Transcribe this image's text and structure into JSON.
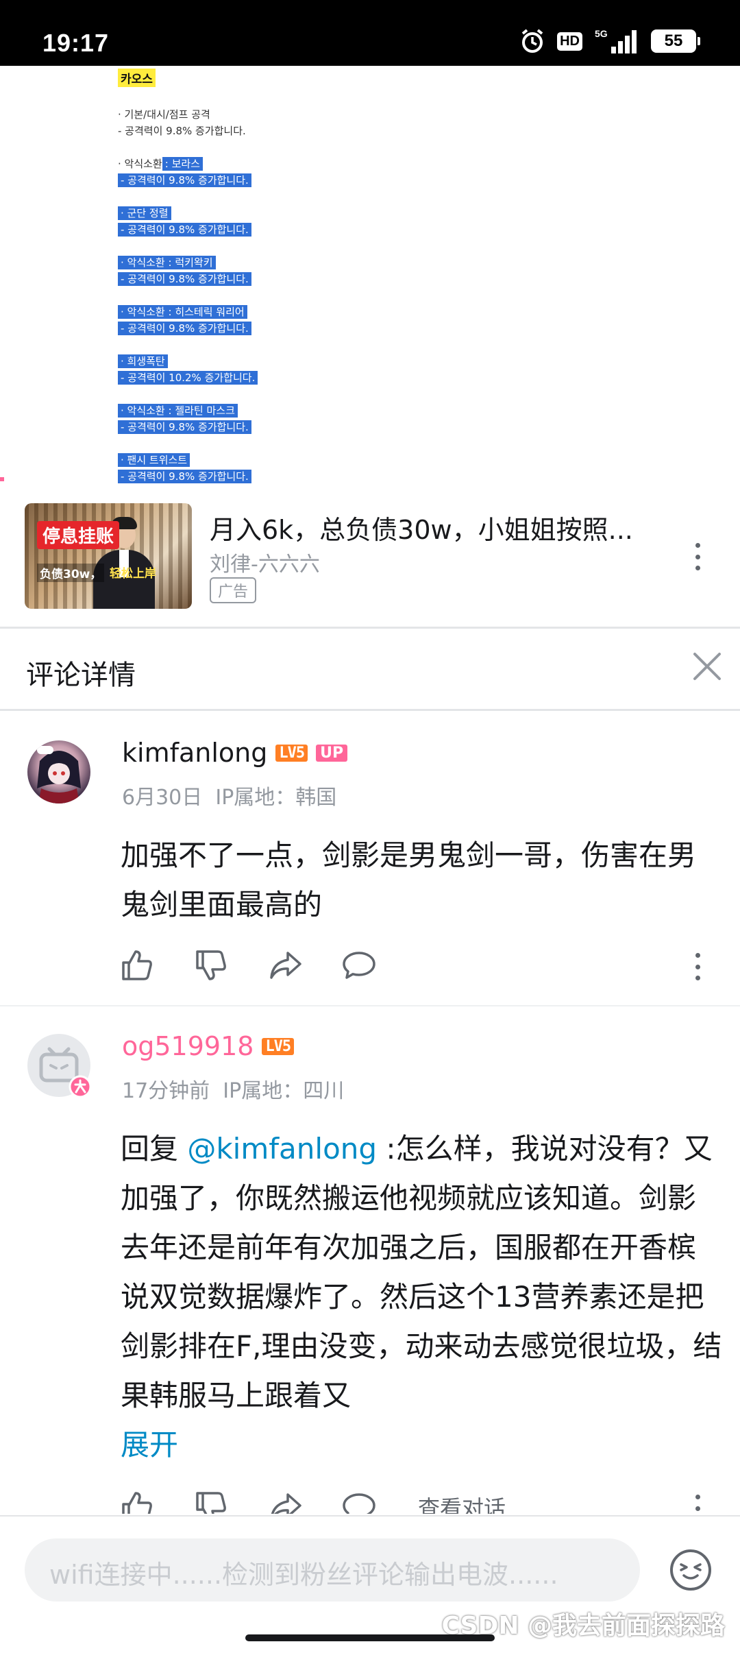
{
  "status_bar": {
    "time": "19:17",
    "network": "5G",
    "hd_label": "HD",
    "battery": "55"
  },
  "patch_note": {
    "title": "카오스",
    "groups": [
      {
        "name": "· 기본/대시/점프 공격",
        "effect": "- 공격력이 9.8% 증가합니다.",
        "highlighted": false
      },
      {
        "name_plain": "· 악식소환",
        "name_hl": ": 보라스",
        "effect": "- 공격력이 9.8% 증가합니다.",
        "highlighted": true
      },
      {
        "name": "· 군단 정렬",
        "effect": "- 공격력이 9.8% 증가합니다.",
        "highlighted": true
      },
      {
        "name": "· 악식소환 : 럭키왁키",
        "effect": "- 공격력이 9.8% 증가합니다.",
        "highlighted": true
      },
      {
        "name": "· 악식소환 : 히스테릭 워리어",
        "effect": "- 공격력이 9.8% 증가합니다.",
        "highlighted": true
      },
      {
        "name": "· 희생폭탄",
        "effect": "- 공격력이 10.2% 증가합니다.",
        "highlighted": true
      },
      {
        "name": "· 악식소환 : 젤라틴 마스크",
        "effect": "- 공격력이 9.8% 증가합니다.",
        "highlighted": true
      },
      {
        "name": "· 팬시 트위스트",
        "effect": "- 공격력이 9.8% 증가합니다.",
        "highlighted": true
      }
    ]
  },
  "ad": {
    "title": "月入6k，总负债30w，小姐姐按照...",
    "author": "刘律-六六六",
    "badge": "广告",
    "thumb_tag": "停息挂账",
    "thumb_caption_white": "负债30w，",
    "thumb_caption_yellow": "轻松上岸"
  },
  "detail": {
    "title": "评论详情"
  },
  "comments": [
    {
      "username": "kimfanlong",
      "level": "LV5",
      "up_badge": "UP",
      "date": "6月30日",
      "ip": "IP属地：韩国",
      "text": "加强不了一点，剑影是男鬼剑一哥，伤害在男鬼剑里面最高的",
      "username_color": "#18191c"
    },
    {
      "username": "og519918",
      "level": "LV5",
      "date": "17分钟前",
      "ip": "IP属地：四川",
      "reply_prefix": "回复 ",
      "mention": "@kimfanlong",
      "text": " :怎么样，我说对没有？又加强了，你既然搬运他视频就应该知道。剑影去年还是前年有次加强之后，国服都在开香槟说双觉数据爆炸了。然后这个13营养素还是把剑影排在F,理由没变，动来动去感觉很垃圾，结果韩服马上跟着又",
      "expand": "展开",
      "view_conversation": "查看对话",
      "username_color": "#ff6699"
    }
  ],
  "input": {
    "placeholder": "wifi连接中......检测到粉丝评论输出电波......"
  },
  "watermark": "CSDN @我去前面探探路",
  "colors": {
    "accent_pink": "#ff6699",
    "link_blue": "#008ac5",
    "level_orange": "#ff7f24",
    "highlight_blue": "#2f6fd6"
  }
}
